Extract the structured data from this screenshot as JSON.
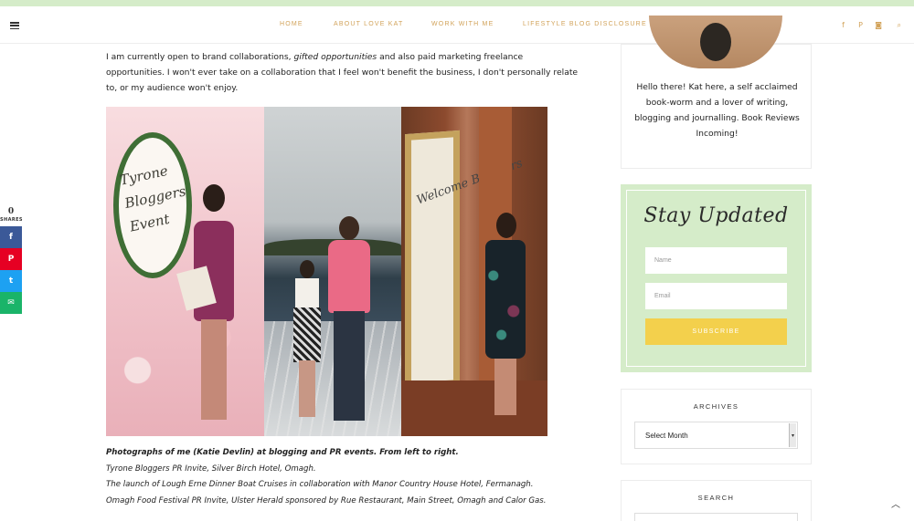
{
  "nav": {
    "items": [
      "HOME",
      "ABOUT LOVE KAT",
      "WORK WITH ME",
      "LIFESTYLE BLOG DISCLOSURE"
    ],
    "social_icons": [
      "facebook-icon",
      "pinterest-icon",
      "instagram-icon",
      "search-icon"
    ]
  },
  "post": {
    "intro_1": "I am currently open to brand collaborations, ",
    "intro_2": "gifted opportunities",
    "intro_3": " and also paid marketing freelance opportunities.  I won't ever take on a collaboration that I feel won't benefit the business, I don't personally relate to, or my audience won't enjoy.",
    "collage": {
      "panel1_text": "Tyrone Bloggers Event",
      "panel3_text": "Welcome Bloggers"
    },
    "caption_title": "Photographs of me (Katie Devlin) at blogging and PR events. From left to right.",
    "caption_lines": [
      "Tyrone Bloggers PR Invite, Silver Birch Hotel, Omagh.",
      "The launch of Lough Erne Dinner Boat Cruises in collaboration with Manor Country House Hotel, Fermanagh.",
      "Omagh Food Festival PR Invite, Ulster Herald sponsored by Rue Restaurant, Main Street, Omagh and Calor Gas."
    ]
  },
  "share": {
    "count": "0",
    "label": "SHARES",
    "buttons": [
      "facebook-icon",
      "pinterest-icon",
      "twitter-icon",
      "email-icon"
    ],
    "glyphs": [
      "f",
      "P",
      "t",
      "✉"
    ]
  },
  "sidebar": {
    "about_text": "Hello there! Kat here, a self acclaimed book-worm and a lover of writing, blogging and journalling. Book Reviews Incoming!",
    "stay_title": "Stay Updated",
    "name_placeholder": "Name",
    "email_placeholder": "Email",
    "subscribe_label": "SUBSCRIBE",
    "archives_title": "ARCHIVES",
    "archives_select": "Select Month",
    "search_title": "SEARCH"
  },
  "colors": {
    "accent": "#d2a35a",
    "mint": "#d5ecc9",
    "subscribe": "#f3d04c"
  }
}
